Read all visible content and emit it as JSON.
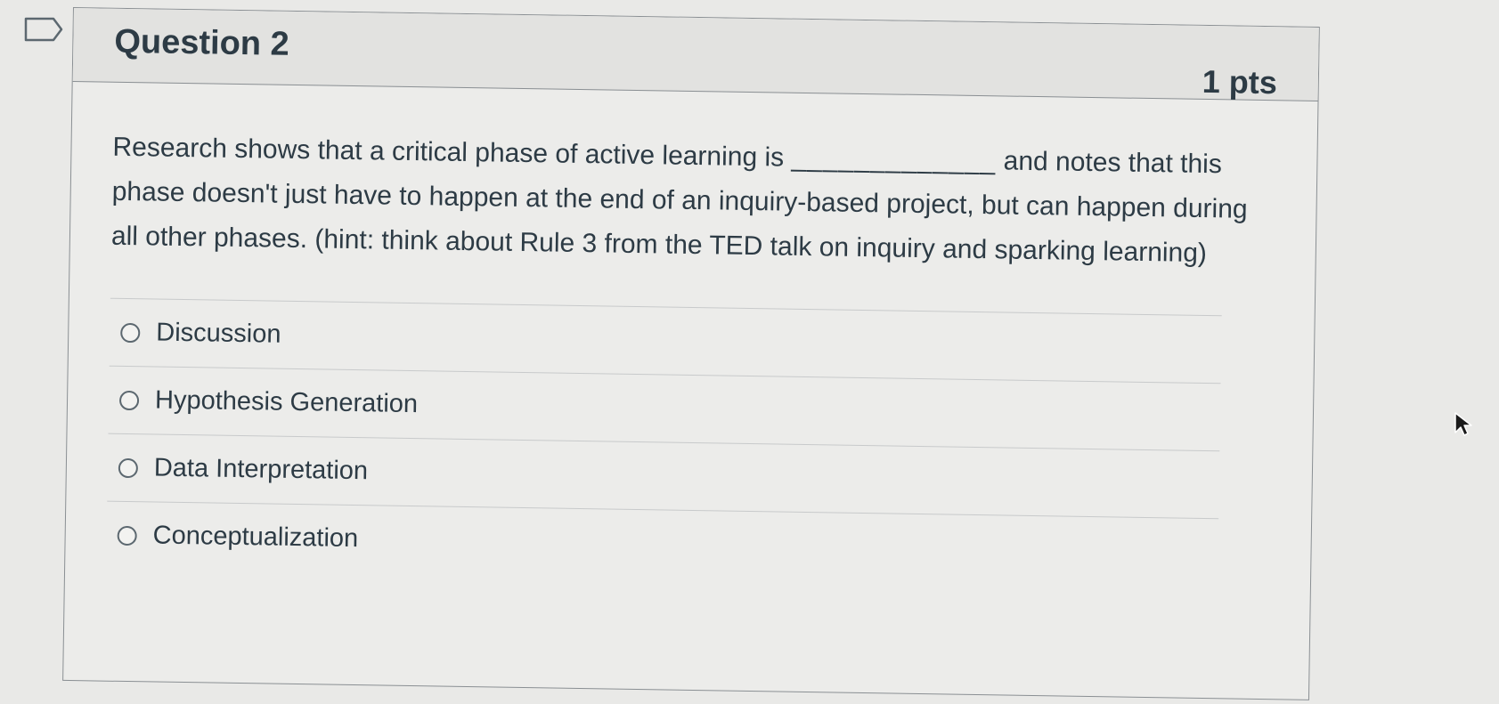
{
  "question": {
    "title": "Question 2",
    "points": "1 pts",
    "text_before_blank": "Research shows that a critical phase of active learning is ",
    "blank": "_____________",
    "text_after_blank": " and notes that this phase doesn't just have to happen at the end of an inquiry-based project, but can happen during all other phases. (hint: think about Rule 3 from the TED talk on inquiry and sparking learning)"
  },
  "answers": [
    {
      "label": "Discussion",
      "selected": false
    },
    {
      "label": "Hypothesis Generation",
      "selected": false
    },
    {
      "label": "Data Interpretation",
      "selected": false
    },
    {
      "label": "Conceptualization",
      "selected": false
    }
  ],
  "icons": {
    "flag": "bookmark-flag-icon",
    "cursor": "mouse-pointer-icon"
  },
  "colors": {
    "text": "#2d3b45",
    "border": "#8a8f93",
    "background": "#e9e9e7"
  }
}
